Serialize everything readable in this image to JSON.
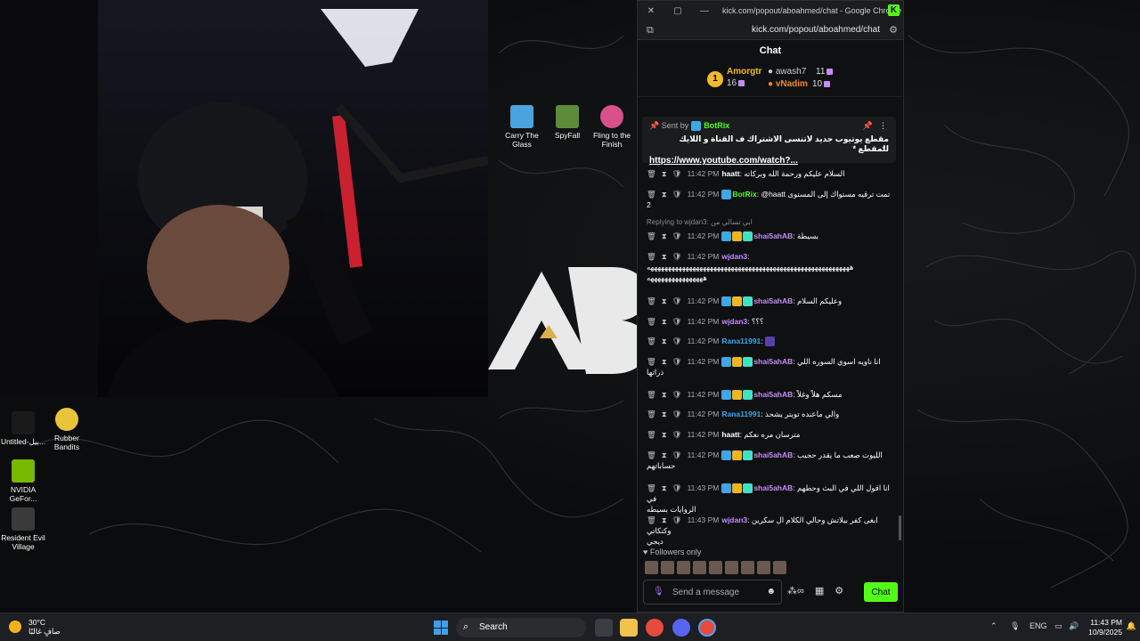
{
  "browser": {
    "window_title": "kick.com/popout/aboahmed/chat - Google Chrome",
    "url": "kick.com/popout/aboahmed/chat",
    "app_badge": "K"
  },
  "chat": {
    "title": "Chat",
    "leaderboard": {
      "rank": "1",
      "first_name": "Amorgtr",
      "first_count": "16",
      "second_name": "awash7",
      "second_count": "11",
      "third_name": "vNadim",
      "third_count": "10"
    },
    "pinned": {
      "sent_by": "Sent by",
      "bot": "BotRix",
      "message": "مقطع يوتيوب جديد لاتنسى الاشتراك ف القناة و اللايك للمقطع *",
      "link": "https://www.youtube.com/watch?..."
    },
    "messages": [
      {
        "time": "11:42 PM",
        "user": "haatt",
        "color": "#ffffff",
        "text": "السلام عليكم ورحمة الله وبركاته"
      },
      {
        "time": "11:42 PM",
        "user": "BotRix",
        "color": "#53fc18",
        "text": "@haatt تمت ترقيه مستواك إلى المستوى",
        "extra": "2"
      },
      {
        "time": "11:42 PM",
        "user": "shai5ahAB",
        "color": "#c58cff",
        "text": "بسيطة"
      },
      {
        "time": "11:42 PM",
        "user": "wjdan3",
        "color": "#c58cff",
        "text": "ههههههههههههههههههههههههههههههههههههههههههههههههههههههههههه",
        "extra": "ههههههههههههههههه"
      },
      {
        "time": "11:42 PM",
        "user": "shai5ahAB",
        "color": "#c58cff",
        "text": "وعليكم السلام"
      },
      {
        "time": "11:42 PM",
        "user": "wjdan3",
        "color": "#c58cff",
        "text": "؟؟؟"
      },
      {
        "time": "11:42 PM",
        "user": "Rana11991",
        "color": "#3fa6e8",
        "text": ""
      },
      {
        "time": "11:42 PM",
        "user": "shai5ahAB",
        "color": "#c58cff",
        "text": "انا ناويه اسوي السوره اللي",
        "extra": "ذراتها"
      },
      {
        "time": "11:42 PM",
        "user": "shai5ahAB",
        "color": "#c58cff",
        "text": "مسكم هلاً وغلاً"
      },
      {
        "time": "11:42 PM",
        "user": "Rana11991",
        "color": "#3fa6e8",
        "text": "والي ماعنده تويتر يشحذ"
      },
      {
        "time": "11:42 PM",
        "user": "haatt",
        "color": "#ffffff",
        "text": "مترسان مره نعكم"
      },
      {
        "time": "11:42 PM",
        "user": "shai5ahAB",
        "color": "#c58cff",
        "text": "الليوت صعب ما يقدر حجيب",
        "extra": "حساباتهم"
      },
      {
        "time": "11:43 PM",
        "user": "shai5ahAB",
        "color": "#c58cff",
        "text": "انا اقول اللي في البث وحطهم في",
        "extra": "الروايات بسيطه"
      },
      {
        "time": "11:43 PM",
        "user": "wjdan3",
        "color": "#c58cff",
        "text": "ابغى كفر بيلاتش وحالي الكلام ال سكرين وكتكاتي",
        "extra": "ديجي"
      }
    ],
    "reply_to": "Replying to wjdan3: ابي تسالي من",
    "followers_only": "Followers only",
    "input_placeholder": "Send a message",
    "send_label": "Chat"
  },
  "desktop": {
    "icons": [
      {
        "label": "Carry The Glass"
      },
      {
        "label": "SpyFall"
      },
      {
        "label": "Fling to the Finish"
      },
      {
        "label": "Untitled-بيل..."
      },
      {
        "label": "Rubber Bandits"
      },
      {
        "label": "NVIDIA GeFor..."
      },
      {
        "label": "Resident Evil Village"
      }
    ]
  },
  "taskbar": {
    "temp": "30°C",
    "weather_text": "صافٍ غالبًا",
    "search_label": "Search",
    "language": "ENG",
    "time": "11:43 PM",
    "date": "10/9/2025"
  },
  "colors": {
    "kick_green": "#53fc18",
    "sub_purple": "#c58cff",
    "gold": "#f2b41e"
  }
}
